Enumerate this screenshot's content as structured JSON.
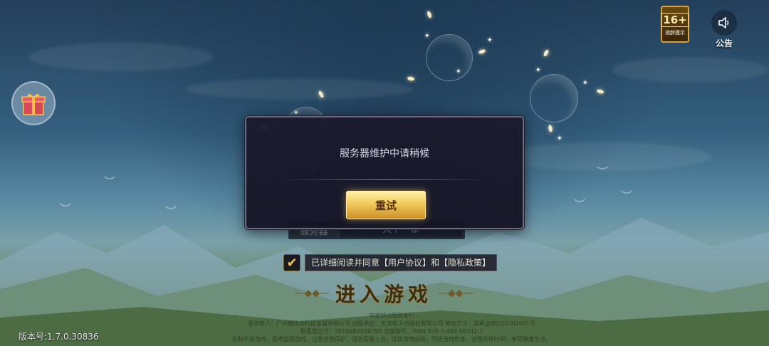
{
  "top_right": {
    "age_rating": "16+",
    "age_rating_label": "适龄提示",
    "notice_label": "公告",
    "notice_icon": "speaker-icon"
  },
  "left": {
    "gift_icon": "gift-icon"
  },
  "dialog": {
    "message": "服务器维护中请稍候",
    "retry_label": "重试"
  },
  "background_ui": {
    "server_label": "服务器",
    "server_value": "天下一家"
  },
  "agreement": {
    "checked": true,
    "text": "已详细阅读并同意【用户协议】和【隐私政策】"
  },
  "enter_game_label": "进入游戏",
  "legal_lines": [
    "中宣部出版局发行",
    "著作权人：广州趣炫动科技发展有限公司 出版单位：天津电子出版社有限公司 审批文号：国新出审[2019]1091号",
    "软著登记号：2019SR0588750 出版物号：ISBN 978-7-498-06342-7",
    "抵制不良游戏，拒绝盗版游戏。注意自我保护，谨防受骗上当。适度游戏益脑，沉迷游戏伤身。合理安排时间，享受健康生活。"
  ],
  "version": "版本号:1.7.0.30836",
  "colors": {
    "dialog_bg": "#1a192c",
    "button_gold": "#f1ca5b",
    "checkbox_tick": "#f0c24a"
  }
}
